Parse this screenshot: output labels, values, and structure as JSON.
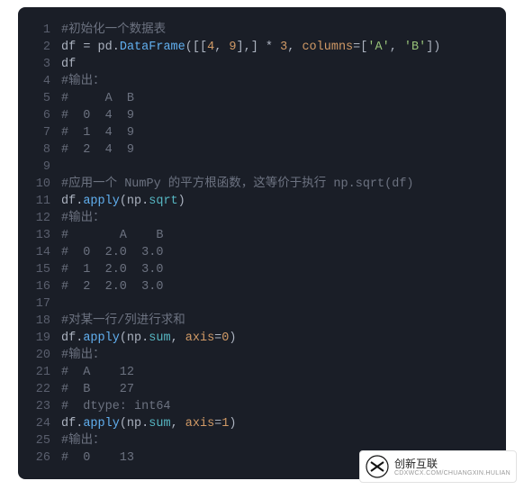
{
  "lines": [
    {
      "n": 1,
      "tokens": [
        {
          "t": "#初始化一个数据表",
          "c": "c"
        }
      ]
    },
    {
      "n": 2,
      "tokens": [
        {
          "t": "df ",
          "c": "id"
        },
        {
          "t": "=",
          "c": "op"
        },
        {
          "t": " pd",
          "c": "id"
        },
        {
          "t": ".",
          "c": "op"
        },
        {
          "t": "DataFrame",
          "c": "fn"
        },
        {
          "t": "([[",
          "c": "op"
        },
        {
          "t": "4",
          "c": "num"
        },
        {
          "t": ", ",
          "c": "op"
        },
        {
          "t": "9",
          "c": "num"
        },
        {
          "t": "],] ",
          "c": "op"
        },
        {
          "t": "*",
          "c": "op"
        },
        {
          "t": " ",
          "c": "op"
        },
        {
          "t": "3",
          "c": "num"
        },
        {
          "t": ", ",
          "c": "op"
        },
        {
          "t": "columns",
          "c": "kw"
        },
        {
          "t": "=",
          "c": "op"
        },
        {
          "t": "[",
          "c": "op"
        },
        {
          "t": "'A'",
          "c": "str"
        },
        {
          "t": ", ",
          "c": "op"
        },
        {
          "t": "'B'",
          "c": "str"
        },
        {
          "t": "])",
          "c": "op"
        }
      ]
    },
    {
      "n": 3,
      "tokens": [
        {
          "t": "df",
          "c": "id"
        }
      ]
    },
    {
      "n": 4,
      "tokens": [
        {
          "t": "#输出：",
          "c": "c"
        }
      ]
    },
    {
      "n": 5,
      "tokens": [
        {
          "t": "#     A  B",
          "c": "c"
        }
      ]
    },
    {
      "n": 6,
      "tokens": [
        {
          "t": "#  0  4  9",
          "c": "c"
        }
      ]
    },
    {
      "n": 7,
      "tokens": [
        {
          "t": "#  1  4  9",
          "c": "c"
        }
      ]
    },
    {
      "n": 8,
      "tokens": [
        {
          "t": "#  2  4  9",
          "c": "c"
        }
      ]
    },
    {
      "n": 9,
      "tokens": [
        {
          "t": "",
          "c": "c"
        }
      ]
    },
    {
      "n": 10,
      "tokens": [
        {
          "t": "#应用一个 NumPy 的平方根函数，这等价于执行 np.sqrt(df)",
          "c": "c"
        }
      ]
    },
    {
      "n": 11,
      "tokens": [
        {
          "t": "df",
          "c": "id"
        },
        {
          "t": ".",
          "c": "op"
        },
        {
          "t": "apply",
          "c": "fn"
        },
        {
          "t": "(np",
          "c": "op"
        },
        {
          "t": ".",
          "c": "op"
        },
        {
          "t": "sqrt",
          "c": "call"
        },
        {
          "t": ")",
          "c": "op"
        }
      ]
    },
    {
      "n": 12,
      "tokens": [
        {
          "t": "#输出：",
          "c": "c"
        }
      ]
    },
    {
      "n": 13,
      "tokens": [
        {
          "t": "#       A    B",
          "c": "c"
        }
      ]
    },
    {
      "n": 14,
      "tokens": [
        {
          "t": "#  0  2.0  3.0",
          "c": "c"
        }
      ]
    },
    {
      "n": 15,
      "tokens": [
        {
          "t": "#  1  2.0  3.0",
          "c": "c"
        }
      ]
    },
    {
      "n": 16,
      "tokens": [
        {
          "t": "#  2  2.0  3.0",
          "c": "c"
        }
      ]
    },
    {
      "n": 17,
      "tokens": [
        {
          "t": "",
          "c": "c"
        }
      ]
    },
    {
      "n": 18,
      "tokens": [
        {
          "t": "#对某一行/列进行求和",
          "c": "c"
        }
      ]
    },
    {
      "n": 19,
      "tokens": [
        {
          "t": "df",
          "c": "id"
        },
        {
          "t": ".",
          "c": "op"
        },
        {
          "t": "apply",
          "c": "fn"
        },
        {
          "t": "(np",
          "c": "op"
        },
        {
          "t": ".",
          "c": "op"
        },
        {
          "t": "sum",
          "c": "call"
        },
        {
          "t": ", ",
          "c": "op"
        },
        {
          "t": "axis",
          "c": "kw"
        },
        {
          "t": "=",
          "c": "op"
        },
        {
          "t": "0",
          "c": "num"
        },
        {
          "t": ")",
          "c": "op"
        }
      ]
    },
    {
      "n": 20,
      "tokens": [
        {
          "t": "#输出：",
          "c": "c"
        }
      ]
    },
    {
      "n": 21,
      "tokens": [
        {
          "t": "#  A    12",
          "c": "c"
        }
      ]
    },
    {
      "n": 22,
      "tokens": [
        {
          "t": "#  B    27",
          "c": "c"
        }
      ]
    },
    {
      "n": 23,
      "tokens": [
        {
          "t": "#  dtype: int64",
          "c": "c"
        }
      ]
    },
    {
      "n": 24,
      "tokens": [
        {
          "t": "df",
          "c": "id"
        },
        {
          "t": ".",
          "c": "op"
        },
        {
          "t": "apply",
          "c": "fn"
        },
        {
          "t": "(np",
          "c": "op"
        },
        {
          "t": ".",
          "c": "op"
        },
        {
          "t": "sum",
          "c": "call"
        },
        {
          "t": ", ",
          "c": "op"
        },
        {
          "t": "axis",
          "c": "kw"
        },
        {
          "t": "=",
          "c": "op"
        },
        {
          "t": "1",
          "c": "num"
        },
        {
          "t": ")",
          "c": "op"
        }
      ]
    },
    {
      "n": 25,
      "tokens": [
        {
          "t": "#输出：",
          "c": "c"
        }
      ]
    },
    {
      "n": 26,
      "tokens": [
        {
          "t": "#  0    13",
          "c": "c"
        }
      ]
    }
  ],
  "watermark": {
    "brand": "创新互联",
    "sub": "CDXWCX.COM/CHUANGXIN.HULIAN"
  }
}
